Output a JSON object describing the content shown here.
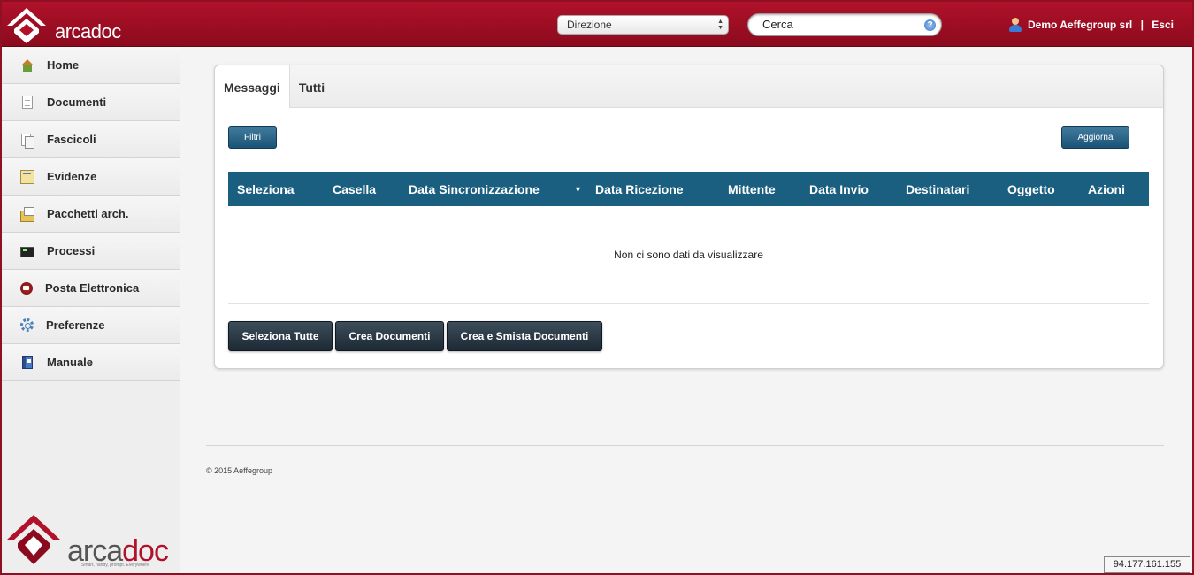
{
  "header": {
    "logo_text": "arcadoc",
    "select_value": "Direzione",
    "search_value": "Cerca",
    "user_name": "Demo Aeffegroup srl",
    "separator": " | ",
    "logout": "Esci"
  },
  "sidebar": {
    "items": [
      {
        "label": "Home",
        "icon": "home-icon"
      },
      {
        "label": "Documenti",
        "icon": "document-icon"
      },
      {
        "label": "Fascicoli",
        "icon": "folders-icon"
      },
      {
        "label": "Evidenze",
        "icon": "notes-icon"
      },
      {
        "label": "Pacchetti arch.",
        "icon": "package-icon"
      },
      {
        "label": "Processi",
        "icon": "console-icon"
      },
      {
        "label": "Posta Elettronica",
        "icon": "mail-seal-icon"
      },
      {
        "label": "Preferenze",
        "icon": "gear-icon"
      },
      {
        "label": "Manuale",
        "icon": "book-icon"
      }
    ],
    "logo_text_a": "arca",
    "logo_text_b": "doc",
    "logo_tagline": "Smart, handy, prompt. Everywhere"
  },
  "panel": {
    "tabs": [
      "Messaggi",
      "Tutti"
    ],
    "filters_label": "Filtri",
    "refresh_label": "Aggiorna",
    "columns": [
      "Seleziona",
      "Casella",
      "Data Sincronizzazione",
      "Data Ricezione",
      "Mittente",
      "Data Invio",
      "Destinatari",
      "Oggetto",
      "Azioni"
    ],
    "sort_indicator": "▼",
    "empty_message": "Non ci sono dati da visualizzare",
    "actions": [
      "Seleziona Tutte",
      "Crea Documenti",
      "Crea e Smista Documenti"
    ]
  },
  "footer": {
    "copyright": "© 2015 Aeffegroup",
    "ip": "94.177.161.155"
  },
  "colors": {
    "brand_red": "#b0122a",
    "table_header": "#1b5f80",
    "dark_button": "#2a3845"
  }
}
